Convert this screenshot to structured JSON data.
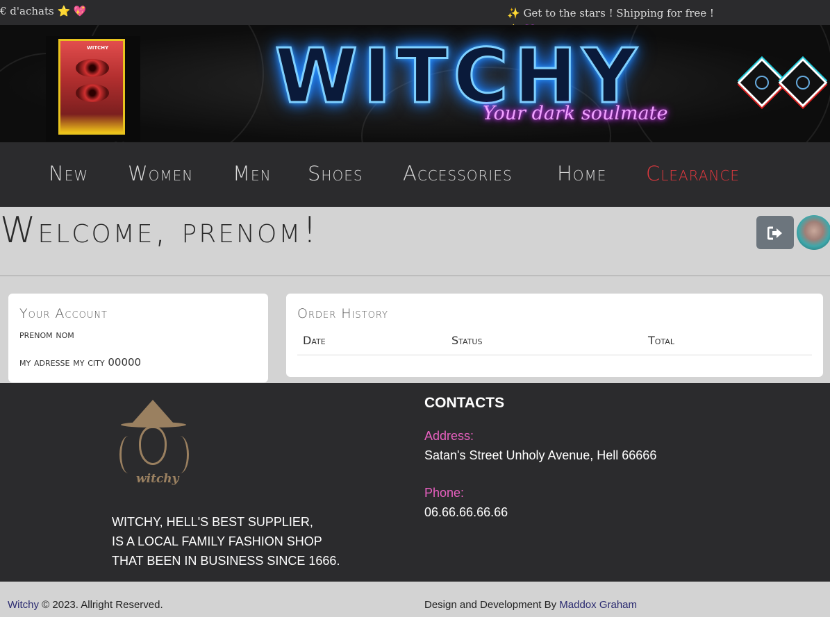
{
  "topbar": {
    "message_left": "€ d'achats ⭐ 💖",
    "message_right": "✨ Get to the stars ! Shipping for free ! 🌟 💜"
  },
  "banner": {
    "poster_tag": "WITCHY",
    "title": "WITCHY",
    "tagline": "Your dark soulmate"
  },
  "nav": {
    "items": [
      {
        "label": "New"
      },
      {
        "label": "Women"
      },
      {
        "label": "Men"
      },
      {
        "label": "Shoes"
      },
      {
        "label": "Accessories"
      },
      {
        "label": "Home"
      },
      {
        "label": "Clearance"
      }
    ]
  },
  "welcome": {
    "heading": "Welcome, prenom!",
    "logout_icon": "sign-out-icon"
  },
  "account": {
    "title": "Your Account",
    "name": "prenom nom",
    "address": "my adresse my city 00000"
  },
  "orders": {
    "title": "Order History",
    "columns": [
      "Date",
      "Status",
      "Total"
    ],
    "rows": []
  },
  "footer": {
    "logo_text": "witchy",
    "about_lines": [
      "WITCHY, HELL'S BEST SUPPLIER,",
      "IS A LOCAL FAMILY FASHION SHOP",
      "THAT BEEN IN BUSINESS SINCE 1666."
    ],
    "contacts_heading": "CONTACTS",
    "address_label": "Address:",
    "address_value": "Satan's Street Unholy Avenue, Hell 66666",
    "phone_label": "Phone:",
    "phone_value": "06.66.66.66.66"
  },
  "bottombar": {
    "brand": "Witchy",
    "copyright": " © 2023. Allright Reserved.",
    "design_text": "Design and Development By ",
    "designer": "Maddox Graham"
  },
  "colors": {
    "dark": "#2b2b2d",
    "clearance": "#e0383e",
    "contact_label": "#e860c0",
    "logout_button": "#6c757d"
  }
}
